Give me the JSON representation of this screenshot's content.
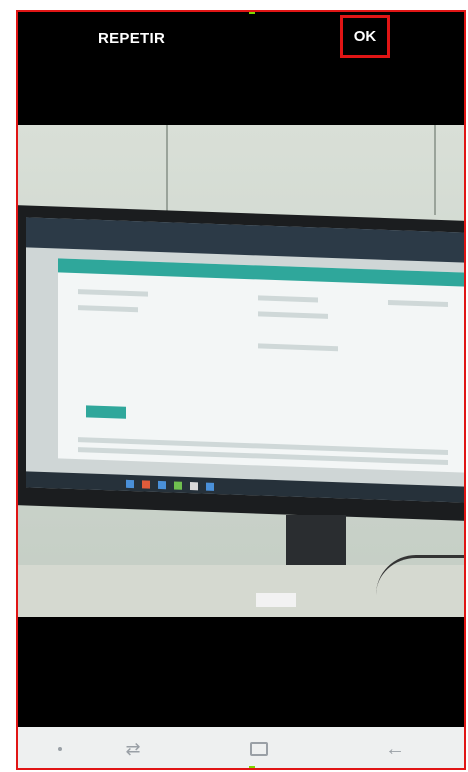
{
  "camera_review": {
    "retake_label": "REPETIR",
    "ok_label": "OK"
  },
  "nav_bar": {
    "menu_icon": "dot-icon",
    "recent_icon": "recent-apps-icon",
    "home_icon": "home-icon",
    "back_icon": "back-arrow-icon"
  },
  "colors": {
    "highlight": "#e01515",
    "accent": "#2fa79b"
  }
}
